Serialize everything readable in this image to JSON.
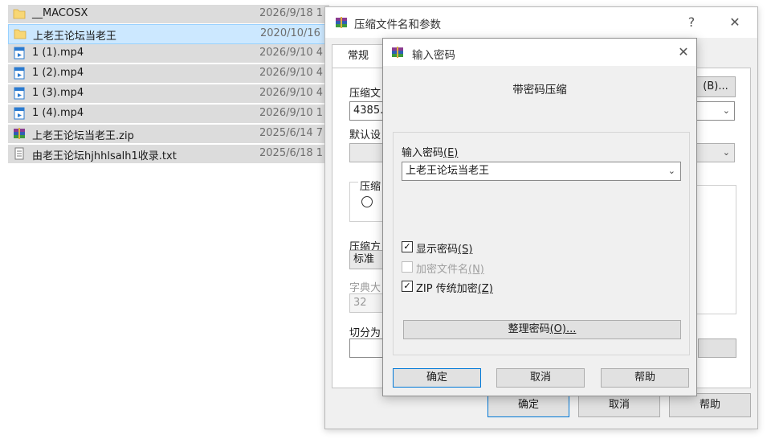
{
  "files": [
    {
      "name": "__MACOSX",
      "date": "2026/9/18 1",
      "type": "folder"
    },
    {
      "name": "上老王论坛当老王",
      "date": "2020/10/16",
      "type": "folder",
      "selected": true
    },
    {
      "name": "1 (1).mp4",
      "date": "2026/9/10 4",
      "type": "video"
    },
    {
      "name": "1 (2).mp4",
      "date": "2026/9/10 4",
      "type": "video"
    },
    {
      "name": "1 (3).mp4",
      "date": "2026/9/10 4",
      "type": "video"
    },
    {
      "name": "1 (4).mp4",
      "date": "2026/9/10 1",
      "type": "video"
    },
    {
      "name": "上老王论坛当老王.zip",
      "date": "2025/6/14 7",
      "type": "archive"
    },
    {
      "name": "由老王论坛hjhhlsalh1收录.txt",
      "date": "2025/6/18 1",
      "type": "text"
    }
  ],
  "archive_dialog": {
    "title": "压缩文件名和参数",
    "help_glyph": "?",
    "close_glyph": "✕",
    "tab_general": "常规",
    "label_archive_name": "压缩文",
    "archive_name_value": "4385.z",
    "browse_label": "(B)...",
    "label_default_profile": "默认设",
    "format_group_label": "压缩",
    "label_method": "压缩方",
    "method_value": "标准",
    "label_dict_size": "字典大",
    "dict_value": "32",
    "label_split": "切分为",
    "ok_label": "确定",
    "cancel_label": "取消",
    "help_label": "帮助"
  },
  "password_dialog": {
    "title": "输入密码",
    "close_glyph": "✕",
    "headline": "带密码压缩",
    "label_enter_password": "输入密码",
    "enter_password_key": "(E)",
    "password_value": "上老王论坛当老王",
    "show_password": "显示密码",
    "show_password_key": "(S)",
    "encrypt_filenames": "加密文件名",
    "encrypt_filenames_key": "(N)",
    "zip_legacy": "ZIP 传统加密",
    "zip_legacy_key": "(Z)",
    "organize_passwords": "整理密码",
    "organize_passwords_key": "(O)...",
    "ok_label": "确定",
    "cancel_label": "取消",
    "help_label": "帮助",
    "show_password_checked": true,
    "encrypt_filenames_checked": false,
    "zip_legacy_checked": true
  },
  "colors": {
    "selected_row": "#cce8ff",
    "row_bg": "#dcdcdc",
    "dialog_bg": "#f0f0f0",
    "button_bg": "#e1e1e1",
    "folder": "#f8d775",
    "video": "#2b7bd0",
    "accent": "#0078d7"
  },
  "icons": {
    "folder": "folder-icon",
    "video": "video-file-icon",
    "archive": "winrar-archive-icon",
    "text": "text-file-icon",
    "app": "winrar-app-icon",
    "close": "close-icon",
    "help": "help-icon",
    "dropdown": "chevron-down-icon",
    "check": "check-icon"
  }
}
